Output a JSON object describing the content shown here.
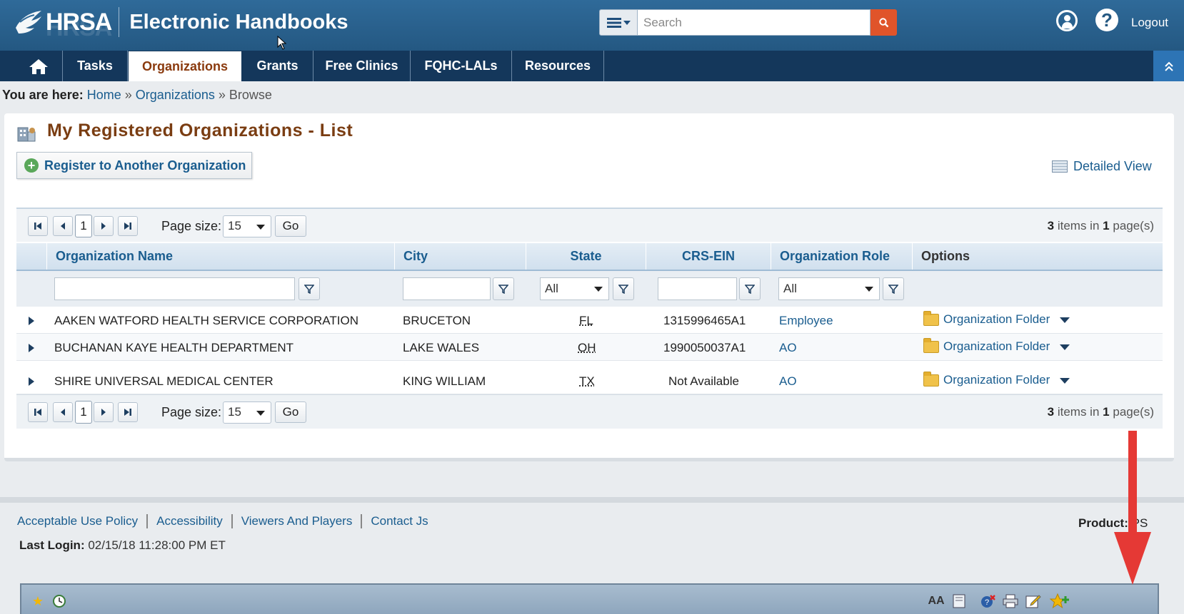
{
  "header": {
    "logo_text": "HRSA",
    "app_title": "Electronic Handbooks",
    "search_placeholder": "Search",
    "logout_label": "Logout"
  },
  "nav": {
    "items": [
      "Tasks",
      "Organizations",
      "Grants",
      "Free Clinics",
      "FQHC-LALs",
      "Resources"
    ],
    "active": "Organizations"
  },
  "breadcrumb": {
    "prefix": "You are here:",
    "home": "Home",
    "sep1": "»",
    "organizations": "Organizations",
    "sep2": "»",
    "current": "Browse"
  },
  "page": {
    "title": "My Registered Organizations - List",
    "register_button": "Register to Another Organization",
    "detailed_view": "Detailed View"
  },
  "pager": {
    "current_page": "1",
    "page_size_label": "Page size:",
    "page_size_value": "15",
    "go_label": "Go",
    "item_count": "3",
    "items_in_text": "items in",
    "page_count": "1",
    "pages_text": "page(s)"
  },
  "grid": {
    "columns": {
      "name": "Organization Name",
      "city": "City",
      "state": "State",
      "ein": "CRS-EIN",
      "role": "Organization Role",
      "options": "Options"
    },
    "filters": {
      "state_value": "All",
      "role_value": "All"
    },
    "rows": [
      {
        "name": "AAKEN WATFORD HEALTH SERVICE CORPORATION",
        "city": "BRUCETON",
        "state": "FL",
        "ein": "1315996465A1",
        "role": "Employee",
        "option": "Organization Folder"
      },
      {
        "name": "BUCHANAN KAYE HEALTH DEPARTMENT",
        "city": "LAKE WALES",
        "state": "OH",
        "ein": "1990050037A1",
        "role": "AO",
        "option": "Organization Folder"
      },
      {
        "name": "SHIRE UNIVERSAL MEDICAL CENTER",
        "city": "KING WILLIAM",
        "state": "TX",
        "ein": "Not Available",
        "role": "AO",
        "option": "Organization Folder"
      }
    ]
  },
  "footer": {
    "links": [
      "Acceptable Use Policy",
      "Accessibility",
      "Viewers And Players",
      "Contact Js"
    ],
    "last_login_label": "Last Login:",
    "last_login_value": "02/15/18 11:28:00 PM ET",
    "product_label": "Product:",
    "product_value": "PS"
  },
  "toolbar": {
    "text_size_label": "AA"
  },
  "colors": {
    "header_blue": "#245882",
    "nav_dark": "#14375b",
    "active_tab_text": "#8a3a0e",
    "link_blue": "#1a5d8f",
    "search_orange": "#e0542a",
    "annotation_red": "#e53935"
  }
}
